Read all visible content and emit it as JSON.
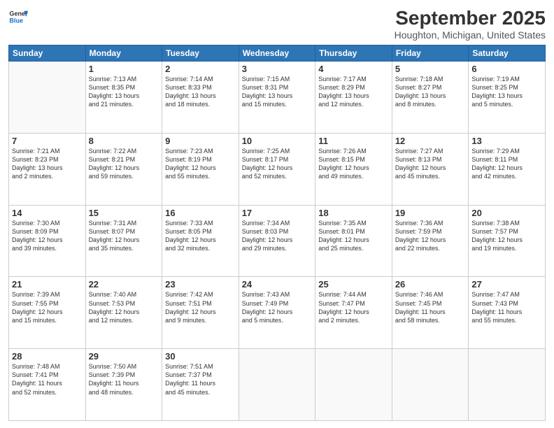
{
  "header": {
    "logo_line1": "General",
    "logo_line2": "Blue",
    "title": "September 2025",
    "subtitle": "Houghton, Michigan, United States"
  },
  "calendar": {
    "days_of_week": [
      "Sunday",
      "Monday",
      "Tuesday",
      "Wednesday",
      "Thursday",
      "Friday",
      "Saturday"
    ],
    "weeks": [
      [
        {
          "day": "",
          "info": ""
        },
        {
          "day": "1",
          "info": "Sunrise: 7:13 AM\nSunset: 8:35 PM\nDaylight: 13 hours\nand 21 minutes."
        },
        {
          "day": "2",
          "info": "Sunrise: 7:14 AM\nSunset: 8:33 PM\nDaylight: 13 hours\nand 18 minutes."
        },
        {
          "day": "3",
          "info": "Sunrise: 7:15 AM\nSunset: 8:31 PM\nDaylight: 13 hours\nand 15 minutes."
        },
        {
          "day": "4",
          "info": "Sunrise: 7:17 AM\nSunset: 8:29 PM\nDaylight: 13 hours\nand 12 minutes."
        },
        {
          "day": "5",
          "info": "Sunrise: 7:18 AM\nSunset: 8:27 PM\nDaylight: 13 hours\nand 8 minutes."
        },
        {
          "day": "6",
          "info": "Sunrise: 7:19 AM\nSunset: 8:25 PM\nDaylight: 13 hours\nand 5 minutes."
        }
      ],
      [
        {
          "day": "7",
          "info": "Sunrise: 7:21 AM\nSunset: 8:23 PM\nDaylight: 13 hours\nand 2 minutes."
        },
        {
          "day": "8",
          "info": "Sunrise: 7:22 AM\nSunset: 8:21 PM\nDaylight: 12 hours\nand 59 minutes."
        },
        {
          "day": "9",
          "info": "Sunrise: 7:23 AM\nSunset: 8:19 PM\nDaylight: 12 hours\nand 55 minutes."
        },
        {
          "day": "10",
          "info": "Sunrise: 7:25 AM\nSunset: 8:17 PM\nDaylight: 12 hours\nand 52 minutes."
        },
        {
          "day": "11",
          "info": "Sunrise: 7:26 AM\nSunset: 8:15 PM\nDaylight: 12 hours\nand 49 minutes."
        },
        {
          "day": "12",
          "info": "Sunrise: 7:27 AM\nSunset: 8:13 PM\nDaylight: 12 hours\nand 45 minutes."
        },
        {
          "day": "13",
          "info": "Sunrise: 7:29 AM\nSunset: 8:11 PM\nDaylight: 12 hours\nand 42 minutes."
        }
      ],
      [
        {
          "day": "14",
          "info": "Sunrise: 7:30 AM\nSunset: 8:09 PM\nDaylight: 12 hours\nand 39 minutes."
        },
        {
          "day": "15",
          "info": "Sunrise: 7:31 AM\nSunset: 8:07 PM\nDaylight: 12 hours\nand 35 minutes."
        },
        {
          "day": "16",
          "info": "Sunrise: 7:33 AM\nSunset: 8:05 PM\nDaylight: 12 hours\nand 32 minutes."
        },
        {
          "day": "17",
          "info": "Sunrise: 7:34 AM\nSunset: 8:03 PM\nDaylight: 12 hours\nand 29 minutes."
        },
        {
          "day": "18",
          "info": "Sunrise: 7:35 AM\nSunset: 8:01 PM\nDaylight: 12 hours\nand 25 minutes."
        },
        {
          "day": "19",
          "info": "Sunrise: 7:36 AM\nSunset: 7:59 PM\nDaylight: 12 hours\nand 22 minutes."
        },
        {
          "day": "20",
          "info": "Sunrise: 7:38 AM\nSunset: 7:57 PM\nDaylight: 12 hours\nand 19 minutes."
        }
      ],
      [
        {
          "day": "21",
          "info": "Sunrise: 7:39 AM\nSunset: 7:55 PM\nDaylight: 12 hours\nand 15 minutes."
        },
        {
          "day": "22",
          "info": "Sunrise: 7:40 AM\nSunset: 7:53 PM\nDaylight: 12 hours\nand 12 minutes."
        },
        {
          "day": "23",
          "info": "Sunrise: 7:42 AM\nSunset: 7:51 PM\nDaylight: 12 hours\nand 9 minutes."
        },
        {
          "day": "24",
          "info": "Sunrise: 7:43 AM\nSunset: 7:49 PM\nDaylight: 12 hours\nand 5 minutes."
        },
        {
          "day": "25",
          "info": "Sunrise: 7:44 AM\nSunset: 7:47 PM\nDaylight: 12 hours\nand 2 minutes."
        },
        {
          "day": "26",
          "info": "Sunrise: 7:46 AM\nSunset: 7:45 PM\nDaylight: 11 hours\nand 58 minutes."
        },
        {
          "day": "27",
          "info": "Sunrise: 7:47 AM\nSunset: 7:43 PM\nDaylight: 11 hours\nand 55 minutes."
        }
      ],
      [
        {
          "day": "28",
          "info": "Sunrise: 7:48 AM\nSunset: 7:41 PM\nDaylight: 11 hours\nand 52 minutes."
        },
        {
          "day": "29",
          "info": "Sunrise: 7:50 AM\nSunset: 7:39 PM\nDaylight: 11 hours\nand 48 minutes."
        },
        {
          "day": "30",
          "info": "Sunrise: 7:51 AM\nSunset: 7:37 PM\nDaylight: 11 hours\nand 45 minutes."
        },
        {
          "day": "",
          "info": ""
        },
        {
          "day": "",
          "info": ""
        },
        {
          "day": "",
          "info": ""
        },
        {
          "day": "",
          "info": ""
        }
      ]
    ]
  }
}
